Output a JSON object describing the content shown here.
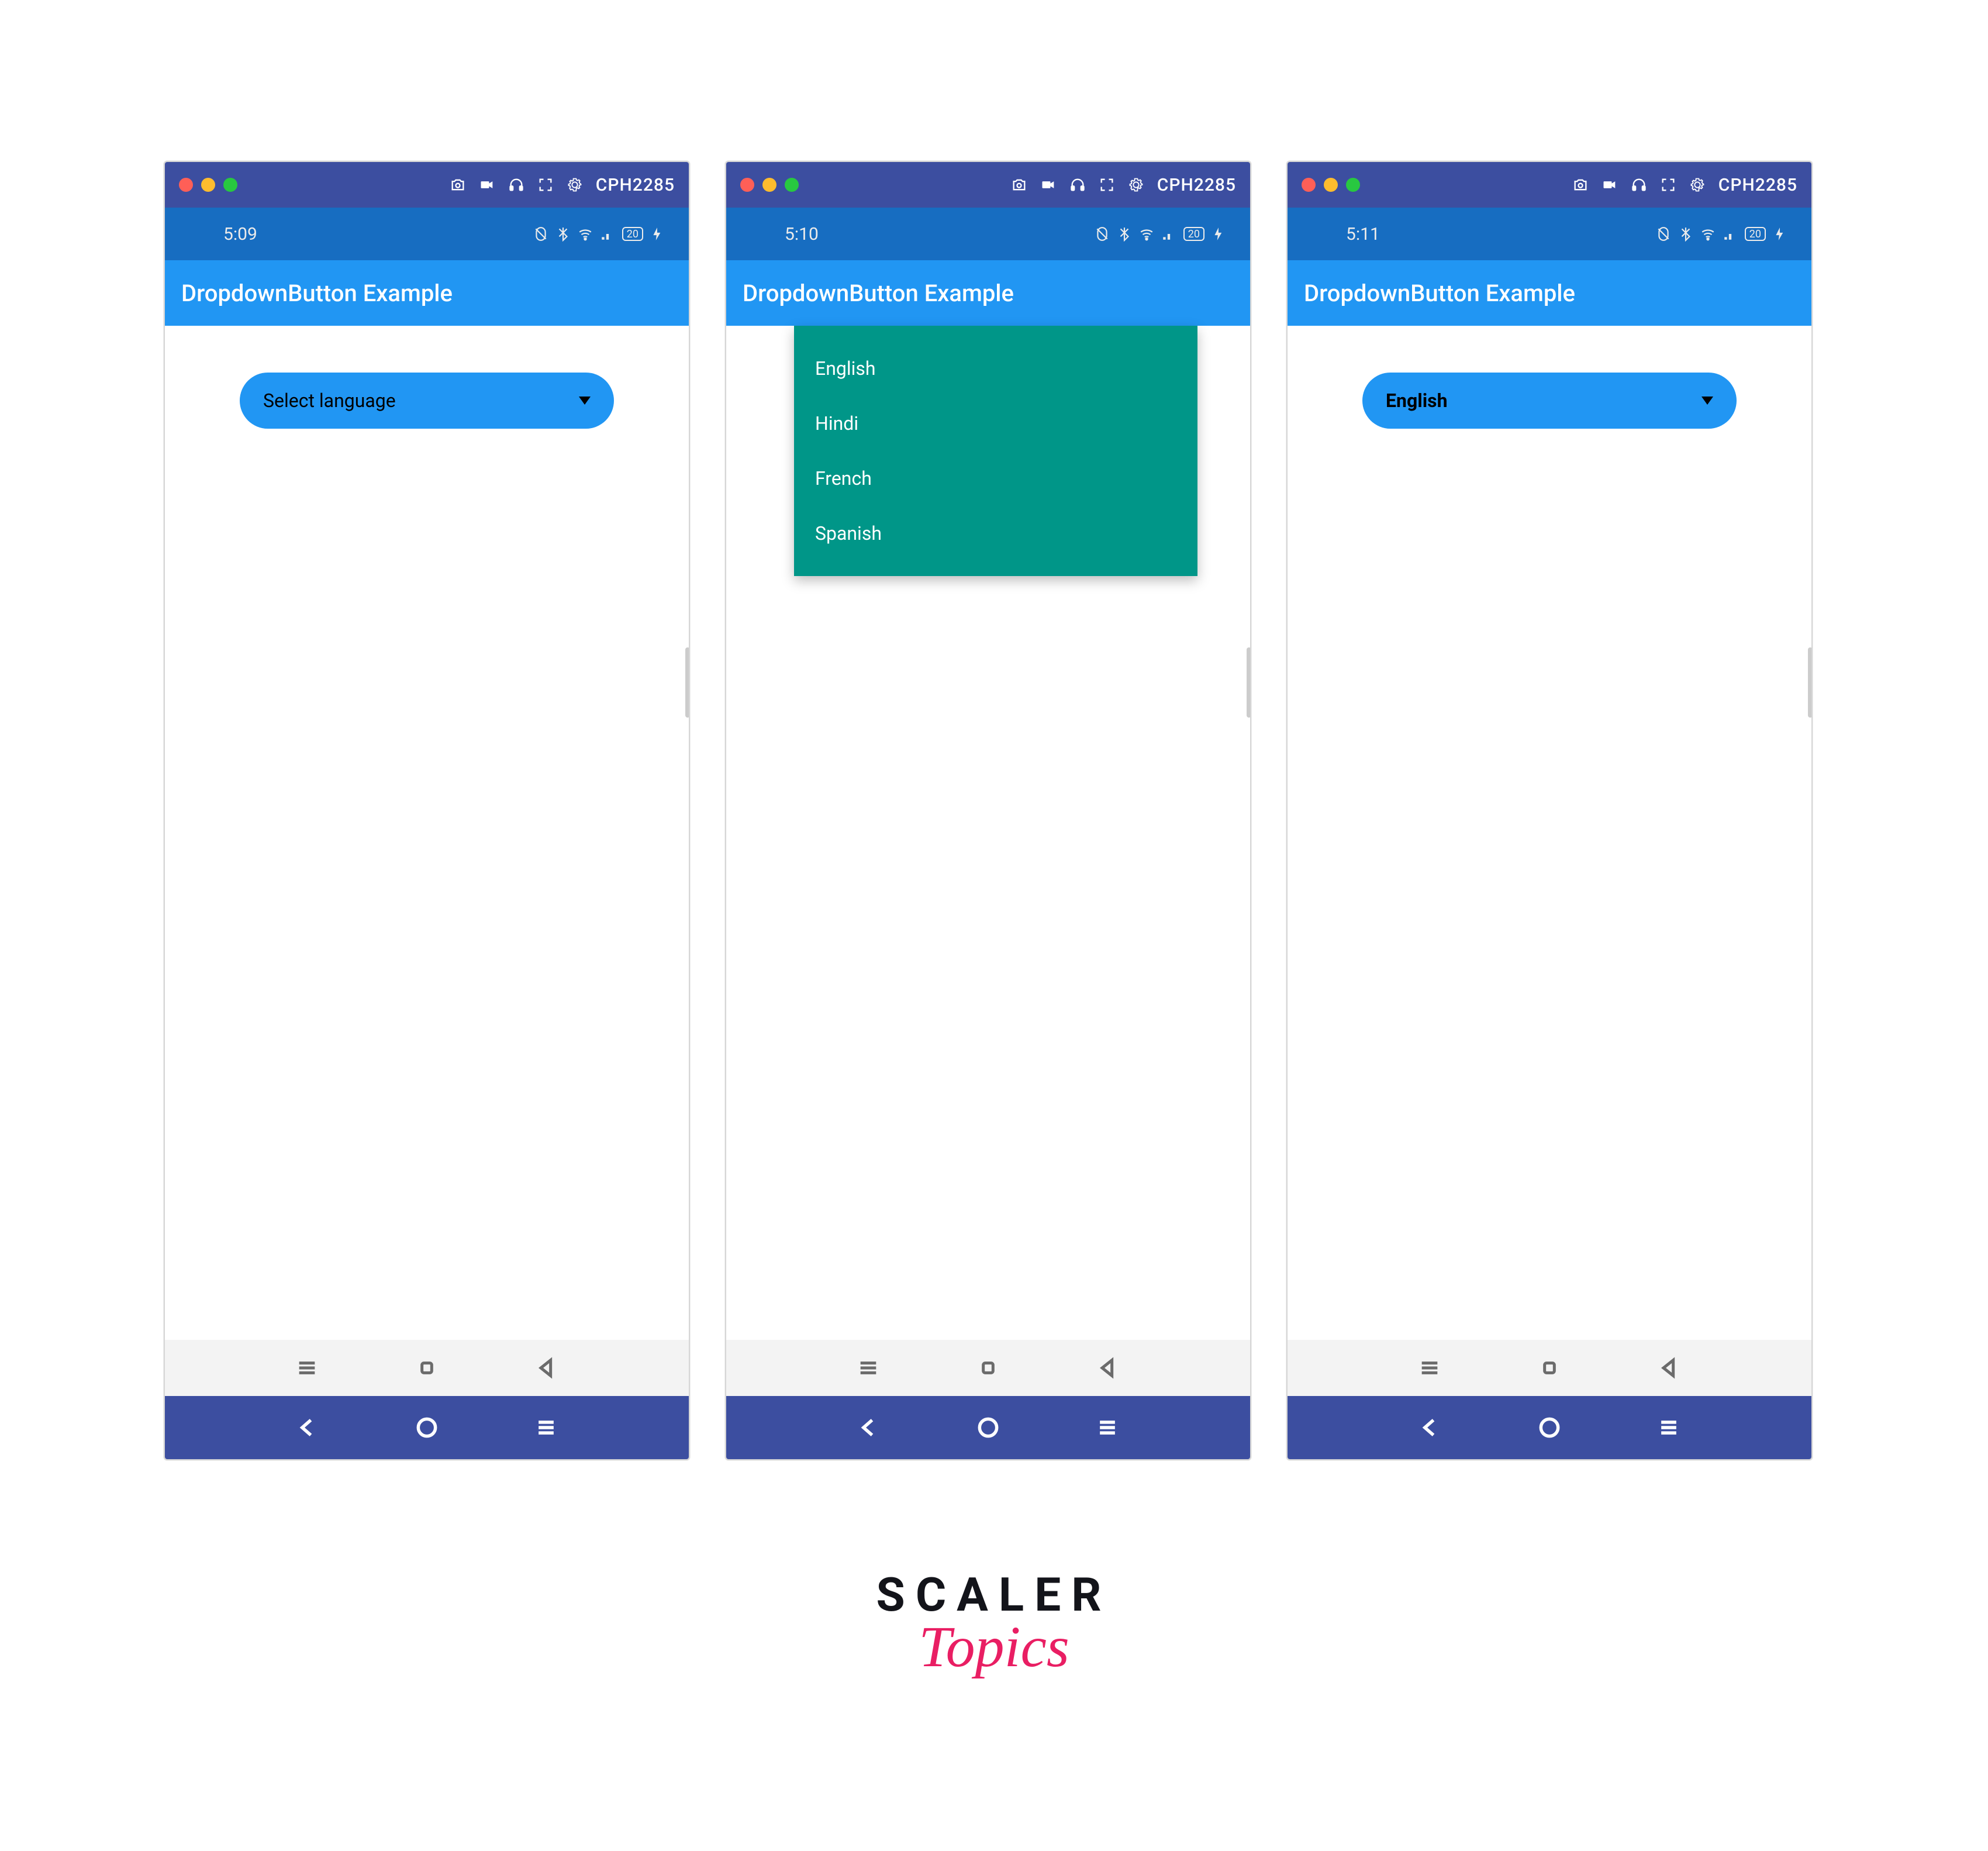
{
  "emu": {
    "device": "CPH2285"
  },
  "screens": [
    {
      "time": "5:09",
      "battery": "20",
      "app_title": "DropdownButton Example",
      "mode": "placeholder",
      "placeholder": "Select language"
    },
    {
      "time": "5:10",
      "battery": "20",
      "app_title": "DropdownButton Example",
      "mode": "open",
      "options": [
        "English",
        "Hindi",
        "French",
        "Spanish"
      ]
    },
    {
      "time": "5:11",
      "battery": "20",
      "app_title": "DropdownButton Example",
      "mode": "selected",
      "selected": "English"
    }
  ],
  "brand": {
    "top": "SCALER",
    "bottom": "Topics"
  }
}
